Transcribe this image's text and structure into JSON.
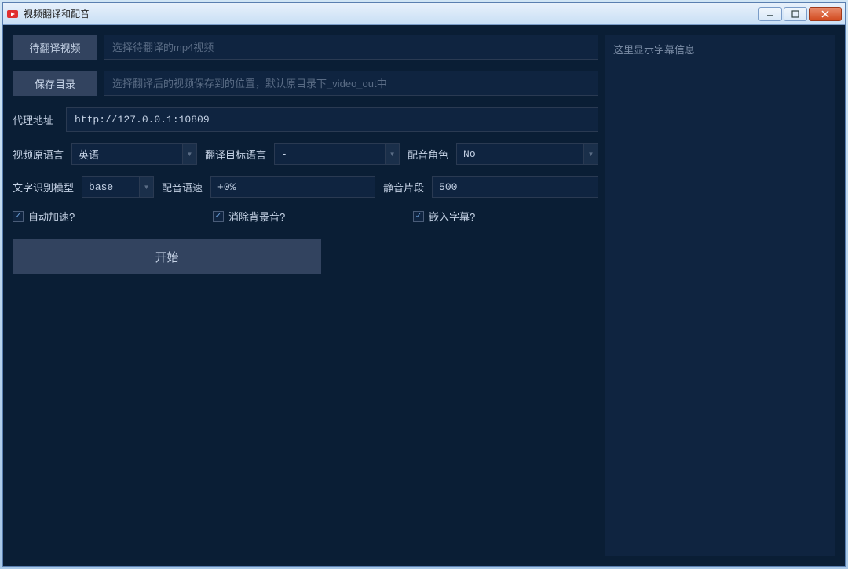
{
  "window": {
    "title": "视频翻译和配音"
  },
  "buttons": {
    "select_video": "待翻译视频",
    "select_dir": "保存目录",
    "start": "开始"
  },
  "placeholders": {
    "video": "选择待翻译的mp4视频",
    "save_dir": "选择翻译后的视频保存到的位置，默认原目录下_video_out中"
  },
  "labels": {
    "proxy": "代理地址",
    "source_lang": "视频原语言",
    "target_lang": "翻译目标语言",
    "voice_role": "配音角色",
    "recog_model": "文字识别模型",
    "voice_rate": "配音语速",
    "silence": "静音片段"
  },
  "values": {
    "proxy": "http://127.0.0.1:10809",
    "source_lang": "英语",
    "target_lang": "-",
    "voice_role": "No",
    "recog_model": "base",
    "voice_rate": "+0%",
    "silence": "500"
  },
  "checks": {
    "auto_accel": "自动加速?",
    "remove_bg": "消除背景音?",
    "embed_sub": "嵌入字幕?"
  },
  "right_panel": {
    "placeholder": "这里显示字幕信息"
  }
}
